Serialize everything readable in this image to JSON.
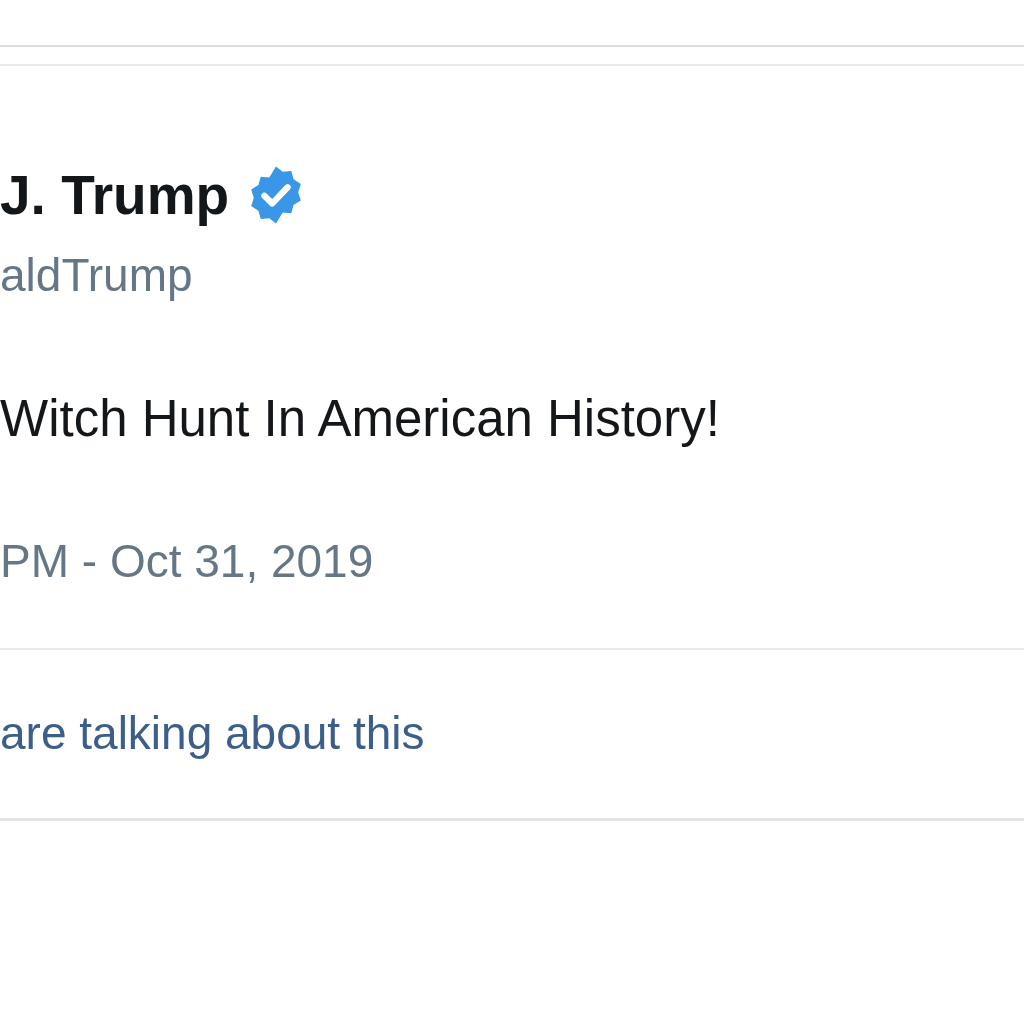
{
  "tweet": {
    "author_name": "J. Trump",
    "verified": true,
    "handle": "aldTrump",
    "text": "Witch Hunt In American History!",
    "timestamp": "PM - Oct 31, 2019"
  },
  "footer": {
    "link": "are talking about this"
  }
}
